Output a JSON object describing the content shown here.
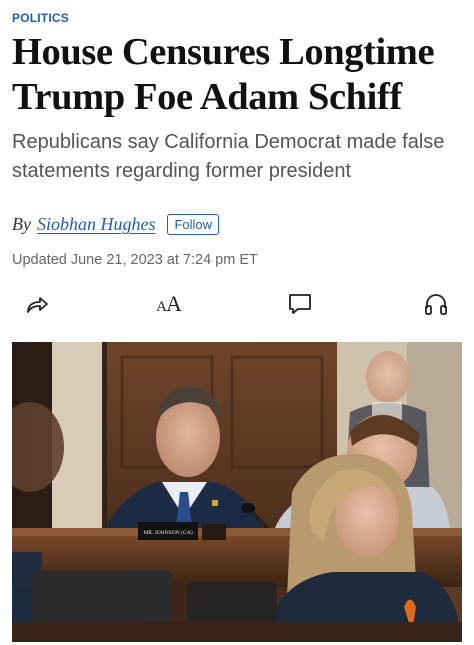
{
  "article": {
    "section": "POLITICS",
    "headline": "House Censures Longtime Trump Foe Adam Schiff",
    "dek": "Republicans say California Democrat made false statements regarding former president",
    "byline": {
      "prefix": "By",
      "author": "Siobhan Hughes",
      "follow_label": "Follow"
    },
    "timestamp": "Updated June 21, 2023 at 7:24 pm ET"
  },
  "toolbar": {
    "icons": [
      "share-icon",
      "font-size-icon",
      "comment-icon",
      "headphones-icon"
    ],
    "font_size_small": "A",
    "font_size_large": "A"
  },
  "photo": {
    "nameplate_text": "MR. JOHNSON (GA)"
  },
  "colors": {
    "accent": "#1f5ea8",
    "headline": "#111111",
    "dek": "#555555",
    "timestamp": "#666666"
  }
}
